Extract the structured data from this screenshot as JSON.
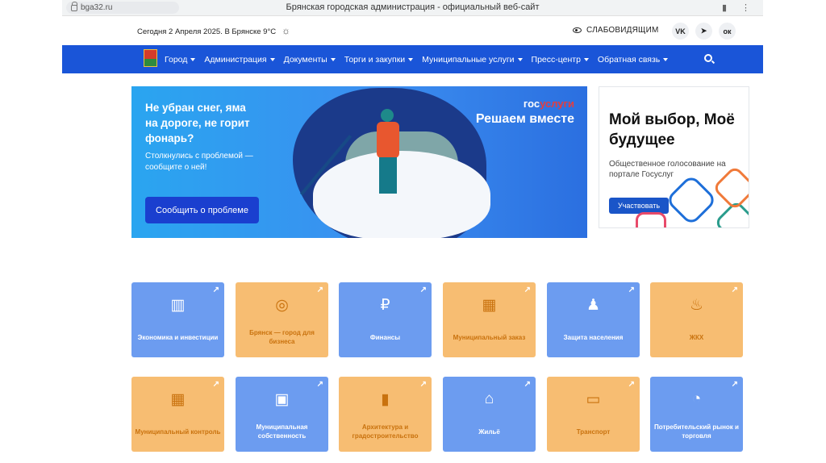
{
  "browser": {
    "url": "bga32.ru",
    "tab_title": "Брянская городская администрация - официальный веб-сайт"
  },
  "topline": {
    "date_weather": "Сегодня 2 Апреля 2025. В Брянске 9°C",
    "weather_icon": "partly-cloudy-icon",
    "visually_impaired": "СЛАБОВИДЯЩИМ",
    "social": [
      "vk",
      "telegram",
      "ok"
    ],
    "social_labels": [
      "VK",
      "➤",
      "ок"
    ]
  },
  "nav": {
    "items": [
      {
        "label": "Город"
      },
      {
        "label": "Администрация"
      },
      {
        "label": "Документы"
      },
      {
        "label": "Торги и закупки"
      },
      {
        "label": "Муниципальные услуги"
      },
      {
        "label": "Пресс-центр"
      },
      {
        "label": "Обратная связь"
      }
    ]
  },
  "hero": {
    "heading": "Не убран снег, яма на дороге, не горит фонарь?",
    "text": "Столкнулись с проблемой — сообщите о ней!",
    "button": "Сообщить о проблеме",
    "brand_a": "гос",
    "brand_b": "услуги",
    "slogan": "Решаем вместе"
  },
  "side_banner": {
    "title": "Мой выбор, Моё будущее",
    "text": "Общественное голосование на портале Госуслуг",
    "button": "Участвовать"
  },
  "colors": {
    "nav_blue": "#1a55d8",
    "tile_blue": "#6c9cf0",
    "tile_orange": "#f7bd72"
  },
  "tiles": [
    {
      "label": "Экономика и инвестиции",
      "icon": "chart-icon",
      "glyph": "▥",
      "color": "blue"
    },
    {
      "label": "Брянск — город для бизнеса",
      "icon": "coins-icon",
      "glyph": "◎",
      "color": "orange"
    },
    {
      "label": "Финансы",
      "icon": "ruble-icon",
      "glyph": "₽",
      "color": "blue"
    },
    {
      "label": "Муниципальный заказ",
      "icon": "buildings-icon",
      "glyph": "▦",
      "color": "orange"
    },
    {
      "label": "Защита населения",
      "icon": "user-shield-icon",
      "glyph": "♟",
      "color": "blue"
    },
    {
      "label": "ЖКХ",
      "icon": "bath-icon",
      "glyph": "♨",
      "color": "orange"
    },
    {
      "label": "Муниципальный контроль",
      "icon": "industry-icon",
      "glyph": "▦",
      "color": "orange"
    },
    {
      "label": "Муниципальная собственность",
      "icon": "building-user-icon",
      "glyph": "▣",
      "color": "blue"
    },
    {
      "label": "Архитектура и градостроительство",
      "icon": "building-icon",
      "glyph": "▮",
      "color": "orange"
    },
    {
      "label": "Жильё",
      "icon": "home-icon",
      "glyph": "⌂",
      "color": "blue"
    },
    {
      "label": "Транспорт",
      "icon": "bus-icon",
      "glyph": "▭",
      "color": "orange"
    },
    {
      "label": "Потребительский рынок и торговля",
      "icon": "pie-chart-icon",
      "glyph": "◔",
      "color": "blue"
    }
  ]
}
